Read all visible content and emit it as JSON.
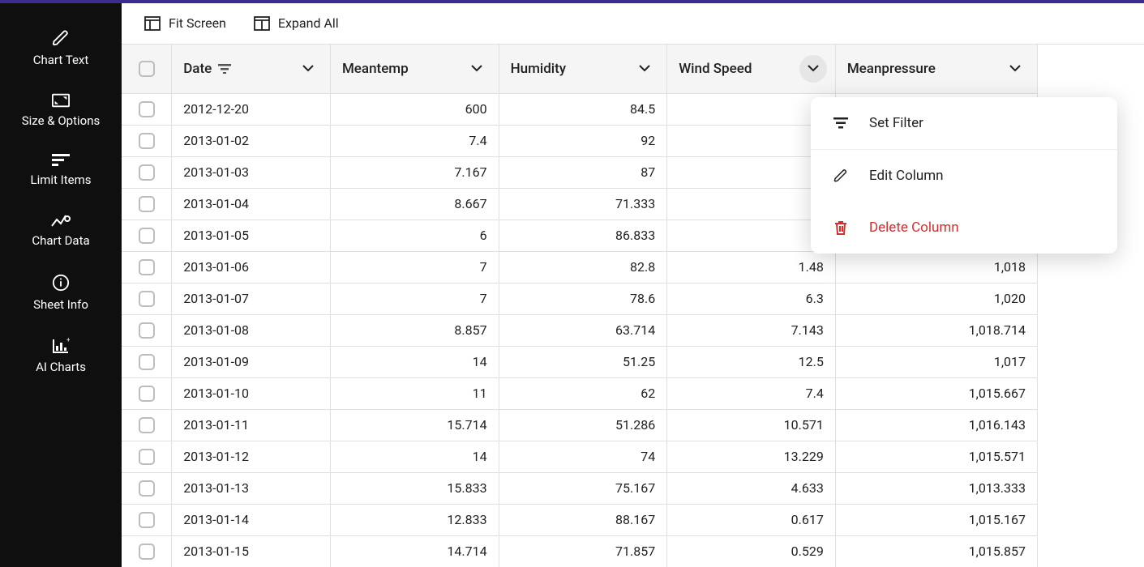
{
  "sidebar": {
    "items": [
      {
        "label": "Chart Text",
        "icon": "pencil-icon"
      },
      {
        "label": "Size & Options",
        "icon": "aspect-ratio-icon"
      },
      {
        "label": "Limit Items",
        "icon": "sort-icon"
      },
      {
        "label": "Chart Data",
        "icon": "chart-line-icon"
      },
      {
        "label": "Sheet Info",
        "icon": "info-icon"
      },
      {
        "label": "AI Charts",
        "icon": "bar-chart-ai-icon"
      }
    ]
  },
  "toolbar": {
    "fit_screen": "Fit Screen",
    "expand_all": "Expand All"
  },
  "table": {
    "columns": [
      {
        "label": "Date",
        "sorted": true
      },
      {
        "label": "Meantemp"
      },
      {
        "label": "Humidity"
      },
      {
        "label": "Wind Speed"
      },
      {
        "label": "Meanpressure"
      }
    ],
    "rows": [
      {
        "date": "2012-12-20",
        "meantemp": "600",
        "humidity": "84.5",
        "wind": "",
        "pressure": ""
      },
      {
        "date": "2013-01-02",
        "meantemp": "7.4",
        "humidity": "92",
        "wind": "",
        "pressure": ""
      },
      {
        "date": "2013-01-03",
        "meantemp": "7.167",
        "humidity": "87",
        "wind": "",
        "pressure": ""
      },
      {
        "date": "2013-01-04",
        "meantemp": "8.667",
        "humidity": "71.333",
        "wind": "",
        "pressure": ""
      },
      {
        "date": "2013-01-05",
        "meantemp": "6",
        "humidity": "86.833",
        "wind": "",
        "pressure": ""
      },
      {
        "date": "2013-01-06",
        "meantemp": "7",
        "humidity": "82.8",
        "wind": "1.48",
        "pressure": "1,018"
      },
      {
        "date": "2013-01-07",
        "meantemp": "7",
        "humidity": "78.6",
        "wind": "6.3",
        "pressure": "1,020"
      },
      {
        "date": "2013-01-08",
        "meantemp": "8.857",
        "humidity": "63.714",
        "wind": "7.143",
        "pressure": "1,018.714"
      },
      {
        "date": "2013-01-09",
        "meantemp": "14",
        "humidity": "51.25",
        "wind": "12.5",
        "pressure": "1,017"
      },
      {
        "date": "2013-01-10",
        "meantemp": "11",
        "humidity": "62",
        "wind": "7.4",
        "pressure": "1,015.667"
      },
      {
        "date": "2013-01-11",
        "meantemp": "15.714",
        "humidity": "51.286",
        "wind": "10.571",
        "pressure": "1,016.143"
      },
      {
        "date": "2013-01-12",
        "meantemp": "14",
        "humidity": "74",
        "wind": "13.229",
        "pressure": "1,015.571"
      },
      {
        "date": "2013-01-13",
        "meantemp": "15.833",
        "humidity": "75.167",
        "wind": "4.633",
        "pressure": "1,013.333"
      },
      {
        "date": "2013-01-14",
        "meantemp": "12.833",
        "humidity": "88.167",
        "wind": "0.617",
        "pressure": "1,015.167"
      },
      {
        "date": "2013-01-15",
        "meantemp": "14.714",
        "humidity": "71.857",
        "wind": "0.529",
        "pressure": "1,015.857"
      }
    ]
  },
  "dropdown": {
    "set_filter": "Set Filter",
    "edit_column": "Edit Column",
    "delete_column": "Delete Column"
  }
}
